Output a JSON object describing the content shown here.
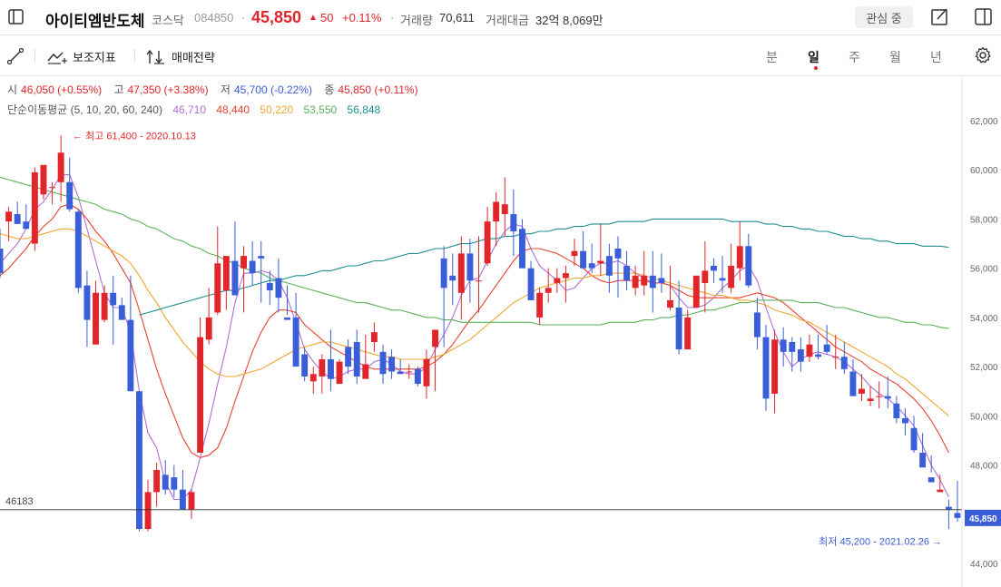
{
  "header": {
    "stock_name": "아이티엠반도체",
    "market": "코스닥",
    "code": "084850",
    "dot": "·",
    "price": "45,850",
    "change_arrow": "▲",
    "change": "50",
    "change_pct": "+0.11%",
    "volume_label": "거래량",
    "volume": "70,611",
    "amount_label": "거래대금",
    "amount": "32억 8,069만",
    "watch_button": "관심 중"
  },
  "toolbar": {
    "indicator_label": "보조지표",
    "strategy_label": "매매전략",
    "periods": [
      "분",
      "일",
      "주",
      "월",
      "년"
    ],
    "active_period": "일"
  },
  "ohlc": {
    "open_label": "시",
    "open": "46,050 (+0.55%)",
    "high_label": "고",
    "high": "47,350 (+3.38%)",
    "low_label": "저",
    "low": "45,700 (-0.22%)",
    "close_label": "종",
    "close": "45,850 (+0.11%)"
  },
  "ma": {
    "label": "단순이동평균 (5, 10, 20, 60, 240)",
    "values": [
      "46,710",
      "48,440",
      "50,220",
      "53,550",
      "56,848"
    ],
    "colors": [
      "#b06fd8",
      "#e8432e",
      "#f0a532",
      "#5bb05b",
      "#1e8f8f"
    ]
  },
  "chart_data": {
    "type": "candlestick",
    "y_range": [
      43600,
      63800
    ],
    "y_ticks": [
      "62,000",
      "60,000",
      "58,000",
      "56,000",
      "54,000",
      "52,000",
      "50,000",
      "48,000",
      "46,000",
      "44,000"
    ],
    "y_tick_values": [
      62000,
      60000,
      58000,
      56000,
      54000,
      52000,
      50000,
      48000,
      46000,
      44000
    ],
    "crosshair_value": 46183,
    "crosshair_label": "46183",
    "last_price_value": 45850,
    "last_price_label": "45,850",
    "max_annotation": "← 최고 61,400 - 2020.10.13",
    "max_value": 61400,
    "min_annotation": "최저 45,200 - 2021.02.26 →",
    "min_value": 45200,
    "up_color": "#e0262b",
    "down_color": "#3a5ed8",
    "candles": [
      [
        56800,
        57600,
        55600,
        55800
      ],
      [
        57900,
        58500,
        57100,
        58300
      ],
      [
        58200,
        58700,
        57800,
        57800
      ],
      [
        57900,
        58600,
        57600,
        57600
      ],
      [
        57000,
        60100,
        56700,
        59900
      ],
      [
        59000,
        60200,
        58800,
        60200
      ],
      [
        59300,
        59500,
        58600,
        59300
      ],
      [
        59500,
        61400,
        58700,
        60700
      ],
      [
        59500,
        60500,
        58300,
        58400
      ],
      [
        58300,
        58400,
        55000,
        55200
      ],
      [
        55300,
        55900,
        52800,
        53900
      ],
      [
        52900,
        55500,
        52900,
        55000
      ],
      [
        53900,
        55300,
        53800,
        55000
      ],
      [
        55000,
        55700,
        52900,
        54500
      ],
      [
        54500,
        54800,
        54000,
        53900
      ],
      [
        53900,
        55700,
        51000,
        51000
      ],
      [
        51000,
        51000,
        45300,
        45400
      ],
      [
        45400,
        47400,
        45300,
        46900
      ],
      [
        46900,
        48100,
        46300,
        47800
      ],
      [
        47600,
        48200,
        46800,
        47000
      ],
      [
        47500,
        48000,
        46700,
        47000
      ],
      [
        47000,
        47800,
        46200,
        46200
      ],
      [
        46200,
        47000,
        45800,
        46900
      ],
      [
        48500,
        54000,
        48500,
        53200
      ],
      [
        53100,
        55200,
        52900,
        54000
      ],
      [
        54200,
        57700,
        54100,
        56200
      ],
      [
        55100,
        55800,
        54300,
        56500
      ],
      [
        56300,
        57900,
        55100,
        54900
      ],
      [
        56000,
        56900,
        54200,
        56500
      ],
      [
        56300,
        57100,
        55300,
        55800
      ],
      [
        56500,
        57100,
        54600,
        56400
      ],
      [
        55400,
        55900,
        54500,
        55100
      ],
      [
        55600,
        56400,
        54200,
        54800
      ],
      [
        54000,
        55300,
        54100,
        53900
      ],
      [
        54000,
        55000,
        53100,
        52000
      ],
      [
        52500,
        52800,
        51400,
        51600
      ],
      [
        51400,
        52000,
        50900,
        51700
      ],
      [
        51600,
        52500,
        50900,
        52300
      ],
      [
        52300,
        53500,
        51000,
        51500
      ],
      [
        51300,
        52300,
        51500,
        52200
      ],
      [
        52800,
        53100,
        51700,
        52000
      ],
      [
        53000,
        53500,
        51300,
        51600
      ],
      [
        51500,
        53300,
        52100,
        52100
      ],
      [
        53000,
        53800,
        52600,
        53400
      ],
      [
        52600,
        52900,
        51300,
        51700
      ],
      [
        52400,
        52700,
        51500,
        51800
      ],
      [
        51800,
        52300,
        51700,
        51700
      ],
      [
        51800,
        52100,
        51500,
        51800
      ],
      [
        51900,
        52000,
        51200,
        51300
      ],
      [
        51200,
        52700,
        50700,
        52300
      ],
      [
        52800,
        52800,
        51000,
        53500
      ],
      [
        56400,
        56900,
        52800,
        55200
      ],
      [
        55700,
        56600,
        54500,
        55500
      ],
      [
        55000,
        57300,
        53900,
        56600
      ],
      [
        56600,
        57200,
        54600,
        55500
      ],
      [
        55500,
        57300,
        54200,
        55500
      ],
      [
        56200,
        58500,
        56100,
        57900
      ],
      [
        57900,
        59100,
        56900,
        58700
      ],
      [
        58200,
        59700,
        57300,
        58600
      ],
      [
        58200,
        59200,
        56500,
        57500
      ],
      [
        57600,
        58000,
        56200,
        56000
      ],
      [
        56000,
        56300,
        54700,
        54700
      ],
      [
        54000,
        55200,
        53700,
        55000
      ],
      [
        55000,
        56000,
        54600,
        55200
      ],
      [
        55400,
        56000,
        55000,
        55600
      ],
      [
        55600,
        56100,
        54600,
        55800
      ],
      [
        56500,
        57200,
        56100,
        56700
      ],
      [
        56700,
        57500,
        56200,
        56000
      ],
      [
        56200,
        57000,
        55800,
        56000
      ],
      [
        56200,
        57800,
        55700,
        56300
      ],
      [
        56500,
        57000,
        55000,
        55700
      ],
      [
        56800,
        57300,
        54800,
        56400
      ],
      [
        56100,
        56700,
        55100,
        55500
      ],
      [
        55200,
        56100,
        54900,
        55700
      ],
      [
        55300,
        56700,
        54900,
        55700
      ],
      [
        55700,
        56700,
        54200,
        55200
      ],
      [
        55600,
        56600,
        55000,
        55400
      ],
      [
        54400,
        56100,
        54300,
        54700
      ],
      [
        54400,
        55500,
        52500,
        52700
      ],
      [
        52700,
        54300,
        52700,
        54000
      ],
      [
        54400,
        55600,
        54400,
        55700
      ],
      [
        55400,
        57100,
        54200,
        55900
      ],
      [
        56100,
        56400,
        55400,
        55900
      ],
      [
        55600,
        56500,
        55000,
        55500
      ],
      [
        55200,
        57000,
        55000,
        56100
      ],
      [
        56000,
        57900,
        55500,
        56900
      ],
      [
        56900,
        57400,
        55200,
        55300
      ],
      [
        54200,
        54800,
        52700,
        53200
      ],
      [
        53200,
        53700,
        50200,
        50700
      ],
      [
        50900,
        53500,
        50100,
        53100
      ],
      [
        53100,
        53600,
        52000,
        52600
      ],
      [
        53000,
        53200,
        51800,
        52600
      ],
      [
        52700,
        53200,
        51800,
        52200
      ],
      [
        52400,
        53300,
        52200,
        52900
      ],
      [
        52500,
        53300,
        52300,
        52400
      ],
      [
        52900,
        53700,
        52500,
        52600
      ],
      [
        52400,
        53300,
        51900,
        52400
      ],
      [
        52400,
        53000,
        51700,
        51900
      ],
      [
        51800,
        52300,
        50900,
        50800
      ],
      [
        50900,
        51700,
        50600,
        51100
      ],
      [
        50600,
        51200,
        50400,
        50700
      ],
      [
        50800,
        51400,
        50300,
        50800
      ],
      [
        50800,
        51600,
        50300,
        50700
      ],
      [
        50500,
        50800,
        49700,
        49900
      ],
      [
        49900,
        50300,
        49200,
        49700
      ],
      [
        49500,
        50000,
        48500,
        48600
      ],
      [
        48500,
        49300,
        48000,
        47900
      ],
      [
        47500,
        48400,
        47700,
        47300
      ],
      [
        46900,
        47600,
        46900,
        47000
      ],
      [
        46300,
        46600,
        45400,
        46200
      ],
      [
        46050,
        47350,
        45700,
        45850
      ]
    ],
    "ma_series": [
      {
        "period": 5,
        "values": [
          56200,
          56600,
          57000,
          57600,
          58400,
          58700,
          59200,
          59800,
          59800,
          58900,
          57600,
          56300,
          55000,
          54400,
          54400,
          53400,
          51000,
          49300,
          48700,
          47300,
          46600,
          46600,
          47000,
          48300,
          49700,
          51300,
          52800,
          54600,
          55800,
          55800,
          55900,
          55800,
          55500,
          54800,
          53800,
          52700,
          52200,
          51800,
          51500,
          51600,
          51800,
          51900,
          51900,
          52200,
          52300,
          52100,
          51800,
          51700,
          51700,
          52000,
          52700,
          53300,
          54000,
          54900,
          55500,
          55600,
          56300,
          57000,
          57500,
          57800,
          57700,
          56800,
          56100,
          55800,
          55500,
          55100,
          55200,
          55600,
          56000,
          56200,
          56200,
          56300,
          56100,
          55800,
          55600,
          55400,
          55400,
          55300,
          54800,
          54400,
          54400,
          54500,
          54800,
          55200,
          55500,
          55900,
          56100,
          55500,
          54400,
          53400,
          52600,
          52000,
          52300,
          52500,
          52600,
          52500,
          52400,
          52200,
          51900,
          51600,
          51200,
          50900,
          50700,
          50400,
          50000,
          49600,
          48800,
          48000,
          47400,
          46700
        ]
      },
      {
        "period": 10,
        "values": [
          55700,
          56000,
          56400,
          56800,
          57300,
          57700,
          58000,
          58500,
          58600,
          58400,
          58000,
          57500,
          57100,
          56600,
          56000,
          55400,
          54300,
          53100,
          51900,
          50900,
          50000,
          49100,
          48500,
          48300,
          48400,
          48700,
          49500,
          50600,
          51600,
          52600,
          53400,
          54000,
          54300,
          54300,
          54200,
          53700,
          53400,
          53100,
          52800,
          52600,
          52400,
          52200,
          52000,
          51900,
          51900,
          51900,
          51900,
          51900,
          51900,
          52000,
          52200,
          52500,
          52900,
          53400,
          53900,
          54300,
          54800,
          55300,
          55800,
          56300,
          56700,
          56800,
          56800,
          56700,
          56600,
          56400,
          56200,
          56000,
          55700,
          55500,
          55400,
          55500,
          55500,
          55500,
          55500,
          55400,
          55400,
          55300,
          55100,
          54900,
          54800,
          54800,
          54800,
          54800,
          54800,
          54800,
          54900,
          55000,
          54900,
          54800,
          54600,
          54300,
          54000,
          53700,
          53400,
          53100,
          52800,
          52600,
          52400,
          52200,
          51900,
          51700,
          51500,
          51300,
          51000,
          50700,
          50300,
          49800,
          49200,
          48500
        ]
      },
      {
        "period": 20,
        "values": [
          57400,
          57300,
          57200,
          57200,
          57300,
          57400,
          57500,
          57600,
          57600,
          57500,
          57300,
          57100,
          56900,
          56700,
          56500,
          56200,
          55700,
          55100,
          54600,
          54000,
          53500,
          53000,
          52600,
          52200,
          51900,
          51700,
          51600,
          51600,
          51700,
          51800,
          51900,
          52100,
          52300,
          52500,
          52700,
          52800,
          52900,
          53000,
          53000,
          52900,
          52800,
          52700,
          52600,
          52500,
          52400,
          52400,
          52300,
          52300,
          52300,
          52300,
          52400,
          52500,
          52700,
          52900,
          53100,
          53400,
          53700,
          54000,
          54300,
          54600,
          54800,
          55000,
          55200,
          55300,
          55400,
          55500,
          55600,
          55600,
          55700,
          55700,
          55800,
          55800,
          55800,
          55800,
          55700,
          55600,
          55500,
          55400,
          55300,
          55200,
          55100,
          55000,
          54900,
          54900,
          54800,
          54700,
          54700,
          54600,
          54500,
          54300,
          54200,
          54100,
          53900,
          53800,
          53600,
          53400,
          53200,
          53000,
          52800,
          52600,
          52400,
          52200,
          52000,
          51700,
          51500,
          51200,
          50900,
          50600,
          50300,
          50000
        ]
      },
      {
        "period": 60,
        "values": [
          59700,
          59600,
          59500,
          59400,
          59300,
          59200,
          59100,
          59000,
          58900,
          58800,
          58700,
          58600,
          58400,
          58300,
          58200,
          58000,
          57900,
          57700,
          57600,
          57400,
          57200,
          57100,
          56900,
          56800,
          56600,
          56500,
          56300,
          56200,
          56000,
          55900,
          55800,
          55600,
          55500,
          55400,
          55300,
          55200,
          55100,
          55000,
          54900,
          54800,
          54700,
          54600,
          54600,
          54500,
          54400,
          54300,
          54300,
          54200,
          54100,
          54000,
          54000,
          53900,
          53900,
          53800,
          53800,
          53800,
          53800,
          53800,
          53800,
          53800,
          53800,
          53800,
          53700,
          53700,
          53700,
          53700,
          53700,
          53700,
          53700,
          53700,
          53800,
          53800,
          53800,
          53800,
          53900,
          53900,
          54000,
          54000,
          54100,
          54100,
          54200,
          54300,
          54300,
          54400,
          54500,
          54600,
          54600,
          54700,
          54700,
          54700,
          54700,
          54700,
          54600,
          54600,
          54600,
          54500,
          54400,
          54400,
          54300,
          54200,
          54100,
          54000,
          54000,
          53900,
          53800,
          53800,
          53700,
          53700,
          53600,
          53550
        ]
      },
      {
        "period": 240,
        "start": 16,
        "values": [
          54100,
          54200,
          54300,
          54400,
          54500,
          54600,
          54700,
          54800,
          54900,
          55000,
          55100,
          55100,
          55200,
          55300,
          55400,
          55500,
          55500,
          55600,
          55700,
          55700,
          55800,
          55900,
          55900,
          56000,
          56100,
          56100,
          56200,
          56300,
          56300,
          56400,
          56500,
          56600,
          56600,
          56700,
          56800,
          56800,
          56900,
          57000,
          57000,
          57100,
          57200,
          57200,
          57300,
          57300,
          57400,
          57400,
          57500,
          57500,
          57600,
          57600,
          57700,
          57700,
          57800,
          57800,
          57800,
          57900,
          57900,
          57900,
          57900,
          58000,
          58000,
          58000,
          58000,
          58000,
          58000,
          58000,
          58000,
          58000,
          57900,
          57900,
          57900,
          57900,
          57800,
          57800,
          57700,
          57700,
          57600,
          57600,
          57500,
          57500,
          57400,
          57300,
          57300,
          57200,
          57200,
          57100,
          57100,
          57000,
          57000,
          57000,
          56900,
          56900,
          56900,
          56850
        ]
      }
    ]
  }
}
